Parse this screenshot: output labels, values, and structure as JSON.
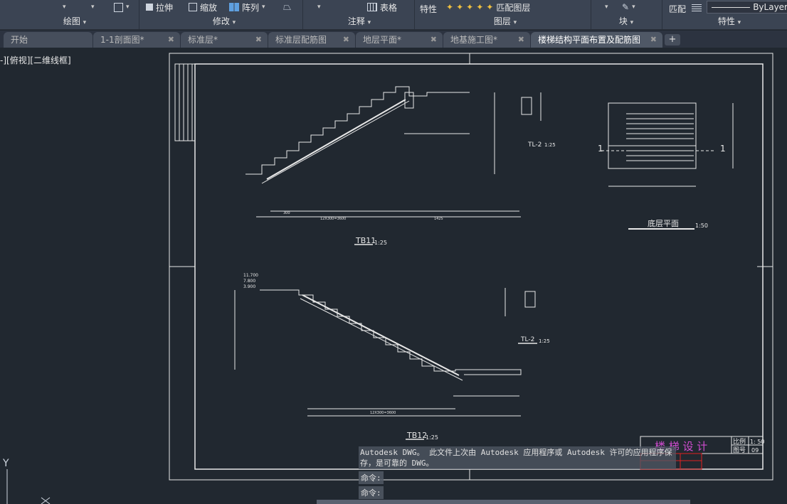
{
  "ribbon": {
    "row1": {
      "stretch": "拉伸",
      "scale": "缩放",
      "array": "阵列",
      "table": "表格",
      "properties_short": "特性",
      "match_layer": "匹配图层",
      "match": "匹配",
      "bylayer": "ByLayer"
    },
    "panels": {
      "draw": "绘图",
      "modify": "修改",
      "annotation": "注释",
      "layers": "图层",
      "block": "块",
      "properties": "特性"
    }
  },
  "tabs": [
    {
      "label": "开始"
    },
    {
      "label": "1-1剖面图*"
    },
    {
      "label": "标准层*"
    },
    {
      "label": "标准层配筋图"
    },
    {
      "label": "地层平面*"
    },
    {
      "label": "地基施工图*"
    },
    {
      "label": "楼梯结构平面布置及配筋图"
    }
  ],
  "viewport_label": "-][俯视][二维线框]",
  "drawing": {
    "tb11": "TB11",
    "tb11_scale": "1:25",
    "tb12": "TB12",
    "tb12_scale": "1:25",
    "tl2": "TL-2",
    "tl2_scale": "1:25",
    "ground_plan": "底层平面",
    "ground_plan_scale": "1:50",
    "section_mark": "1",
    "title_block_name": "楼 梯 设 计",
    "scale_label": "比例",
    "scale_value": "1: 50",
    "sheet_label": "图号",
    "sheet_value": "09",
    "elev_top": "11.700",
    "elev_mid": "7.800",
    "elev_low": "3.900",
    "dim_300": "300",
    "dim_1425": "1425",
    "dim_total": "12X300=3600",
    "ucs_y": "Y",
    "ucs_x": "X"
  },
  "command": {
    "message": "Autodesk DWG。  此文件上次由 Autodesk 应用程序或 Autodesk 许可的应用程序保存，是可靠的 DWG。",
    "prompt1": "命令:",
    "prompt2": "命令:"
  }
}
